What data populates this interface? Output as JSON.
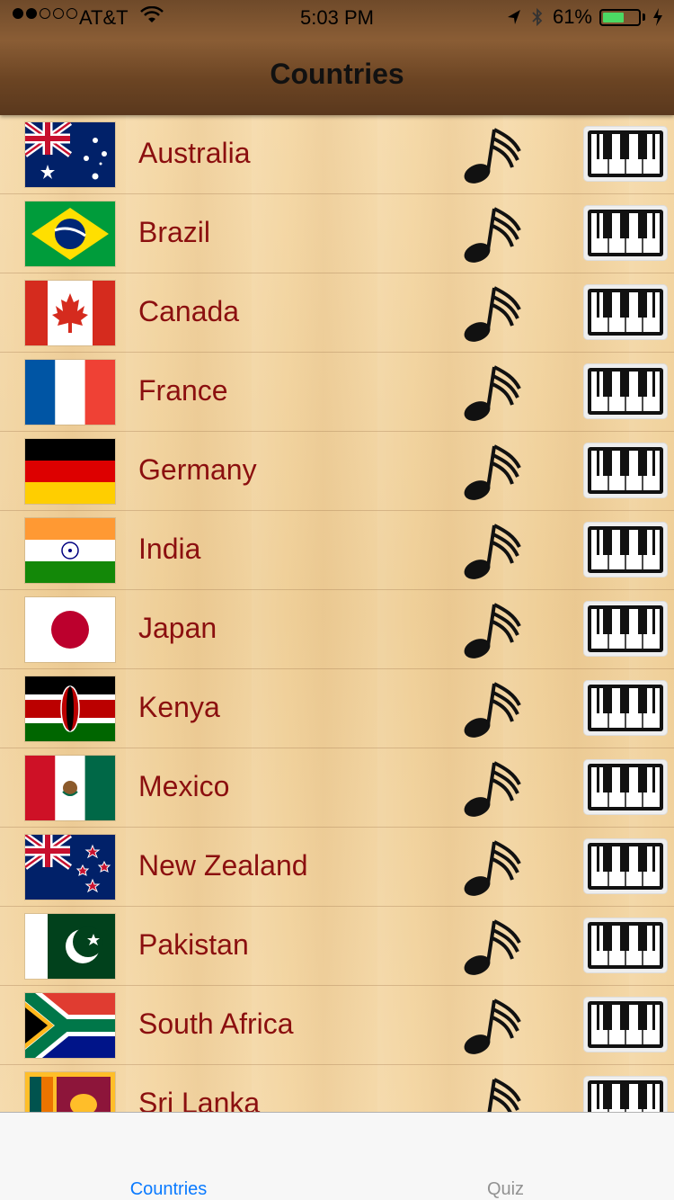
{
  "status_bar": {
    "carrier": "AT&T",
    "time": "5:03 PM",
    "battery": "61%",
    "signal_bars_filled": 2,
    "signal_bars_total": 5,
    "battery_level": 0.61
  },
  "nav": {
    "title": "Countries"
  },
  "countries": [
    {
      "name": "Australia",
      "flag": "australia-flag"
    },
    {
      "name": "Brazil",
      "flag": "brazil-flag"
    },
    {
      "name": "Canada",
      "flag": "canada-flag"
    },
    {
      "name": "France",
      "flag": "france-flag"
    },
    {
      "name": "Germany",
      "flag": "germany-flag"
    },
    {
      "name": "India",
      "flag": "india-flag"
    },
    {
      "name": "Japan",
      "flag": "japan-flag"
    },
    {
      "name": "Kenya",
      "flag": "kenya-flag"
    },
    {
      "name": "Mexico",
      "flag": "mexico-flag"
    },
    {
      "name": "New Zealand",
      "flag": "new-zealand-flag"
    },
    {
      "name": "Pakistan",
      "flag": "pakistan-flag"
    },
    {
      "name": "South Africa",
      "flag": "south-africa-flag"
    },
    {
      "name": "Sri Lanka",
      "flag": "sri-lanka-flag"
    }
  ],
  "row_icons": {
    "anthem": "music-note-icon",
    "instrumental": "piano-keys-icon"
  },
  "tabs": [
    {
      "label": "Countries",
      "active": true
    },
    {
      "label": "Quiz",
      "active": false
    }
  ],
  "colors": {
    "country_text": "#8b0f0f",
    "tab_active": "#0a7aff",
    "tab_inactive": "#929292"
  }
}
